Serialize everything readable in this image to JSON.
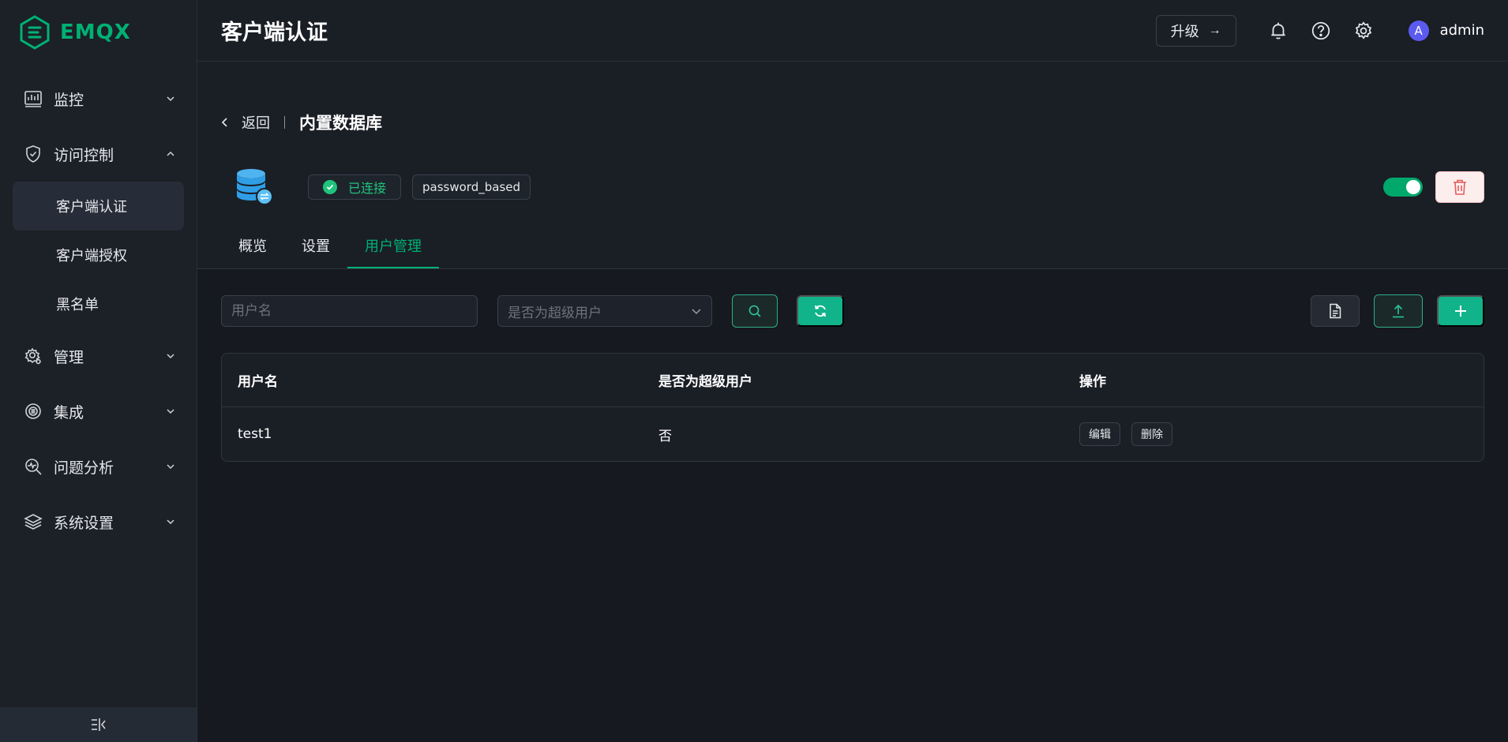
{
  "brand": {
    "name": "EMQX",
    "color": "#00b173"
  },
  "sidebar": {
    "items": [
      {
        "label": "监控",
        "icon": "monitor-icon",
        "expanded": false
      },
      {
        "label": "访问控制",
        "icon": "shield-icon",
        "expanded": true,
        "children": [
          {
            "label": "客户端认证",
            "active": true
          },
          {
            "label": "客户端授权",
            "active": false
          },
          {
            "label": "黑名单",
            "active": false
          }
        ]
      },
      {
        "label": "管理",
        "icon": "gear-people-icon",
        "expanded": false
      },
      {
        "label": "集成",
        "icon": "integration-icon",
        "expanded": false
      },
      {
        "label": "问题分析",
        "icon": "diagnose-icon",
        "expanded": false
      },
      {
        "label": "系统设置",
        "icon": "layers-icon",
        "expanded": false
      }
    ],
    "collapse_icon": "collapse-sidebar-icon"
  },
  "header": {
    "title": "客户端认证",
    "upgrade_label": "升级",
    "user": {
      "avatar_letter": "A",
      "name": "admin"
    }
  },
  "breadcrumb": {
    "back_label": "返回",
    "title": "内置数据库"
  },
  "auth": {
    "status_label": "已连接",
    "mechanism": "password_based",
    "enabled": true
  },
  "tabs": [
    {
      "label": "概览",
      "active": false
    },
    {
      "label": "设置",
      "active": false
    },
    {
      "label": "用户管理",
      "active": true
    }
  ],
  "filters": {
    "username_placeholder": "用户名",
    "superuser_placeholder": "是否为超级用户"
  },
  "table": {
    "columns": [
      "用户名",
      "是否为超级用户",
      "操作"
    ],
    "rows": [
      {
        "username": "test1",
        "is_superuser": "否",
        "actions": [
          "编辑",
          "删除"
        ]
      }
    ]
  },
  "colors": {
    "accent": "#00b173",
    "danger": "#e35d5d",
    "connected": "#1fc47c"
  }
}
